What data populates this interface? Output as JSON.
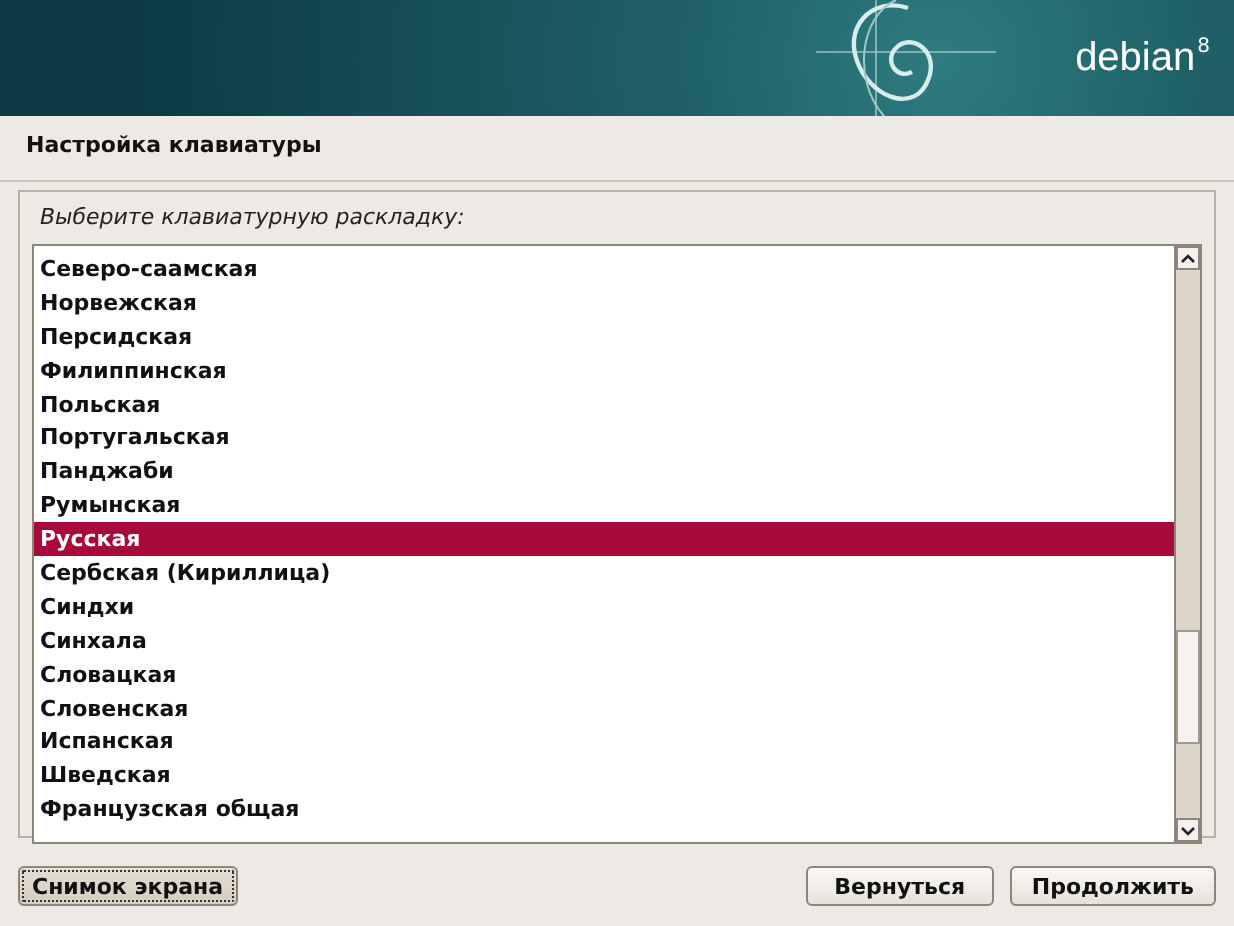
{
  "header": {
    "logo_text": "debian",
    "version": "8"
  },
  "title": "Настройка клавиатуры",
  "prompt": "Выберите клавиатурную раскладку:",
  "layouts": [
    {
      "label": "Северо-саамская",
      "selected": false
    },
    {
      "label": "Норвежская",
      "selected": false
    },
    {
      "label": "Персидская",
      "selected": false
    },
    {
      "label": "Филиппинская",
      "selected": false
    },
    {
      "label": "Польская",
      "selected": false
    },
    {
      "label": "Португальская",
      "selected": false
    },
    {
      "label": "Панджаби",
      "selected": false
    },
    {
      "label": "Румынская",
      "selected": false
    },
    {
      "label": "Русская",
      "selected": true
    },
    {
      "label": "Сербская (Кириллица)",
      "selected": false
    },
    {
      "label": "Синдхи",
      "selected": false
    },
    {
      "label": "Синхала",
      "selected": false
    },
    {
      "label": "Словацкая",
      "selected": false
    },
    {
      "label": "Словенская",
      "selected": false
    },
    {
      "label": "Испанская",
      "selected": false
    },
    {
      "label": "Шведская",
      "selected": false
    },
    {
      "label": "Французская общая",
      "selected": false
    }
  ],
  "buttons": [
    {
      "label": "Снимок экрана",
      "focused": true
    },
    {
      "label": "Вернуться",
      "focused": false
    },
    {
      "label": "Продолжить",
      "focused": false
    }
  ]
}
